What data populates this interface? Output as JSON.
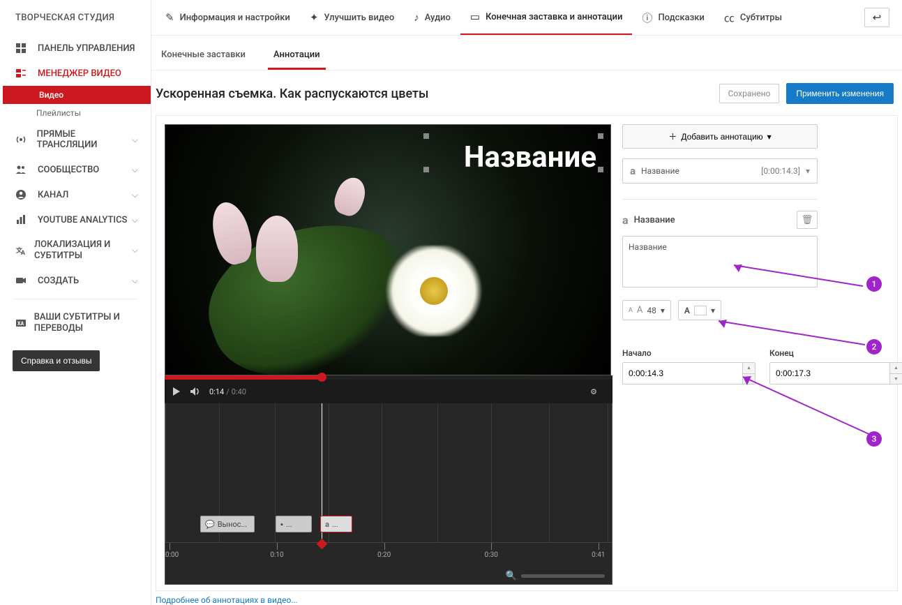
{
  "logo": "ТВОРЧЕСКАЯ СТУДИЯ",
  "sidebar": {
    "dashboard": "ПАНЕЛЬ УПРАВЛЕНИЯ",
    "video_manager": "МЕНЕДЖЕР ВИДЕО",
    "sub_videos": "Видео",
    "sub_playlists": "Плейлисты",
    "live": "ПРЯМЫЕ ТРАНСЛЯЦИИ",
    "community": "СООБЩЕСТВО",
    "channel": "КАНАЛ",
    "analytics": "YOUTUBE ANALYTICS",
    "localization": "ЛОКАЛИЗАЦИЯ И СУБТИТРЫ",
    "create": "СОЗДАТЬ",
    "your_subs": "ВАШИ СУБТИТРЫ И ПЕРЕВОДЫ",
    "feedback": "Справка и отзывы"
  },
  "tabs": {
    "info": "Информация и настройки",
    "enhance": "Улучшить видео",
    "audio": "Аудио",
    "endcards": "Конечная заставка и аннотации",
    "hints": "Подсказки",
    "subtitles": "Субтитры"
  },
  "subtabs": {
    "endcards": "Конечные заставки",
    "annotations": "Аннотации"
  },
  "title": "Ускоренная съемка. Как распускаются цветы",
  "status": "Сохранено",
  "apply": "Применить изменения",
  "preview_overlay": "Название",
  "player": {
    "current": "0:14",
    "duration": "0:40"
  },
  "timeline": {
    "chip1": "Вынос...",
    "chip2": "...",
    "chip3_glyph": "a",
    "ticks": [
      "0:00",
      "0:10",
      "0:20",
      "0:30",
      "0:41"
    ]
  },
  "rpanel": {
    "add": "Добавить аннотацию",
    "item_label": "Название",
    "item_time": "[0:00:14.3]",
    "name_head": "Название",
    "text_value": "Название",
    "font_size": "48",
    "start_label": "Начало",
    "end_label": "Конец",
    "start_value": "0:00:14.3",
    "end_value": "0:00:17.3"
  },
  "more_link": "Подробнее об аннотациях в видео...",
  "callouts": {
    "n1": "1",
    "n2": "2",
    "n3": "3"
  }
}
